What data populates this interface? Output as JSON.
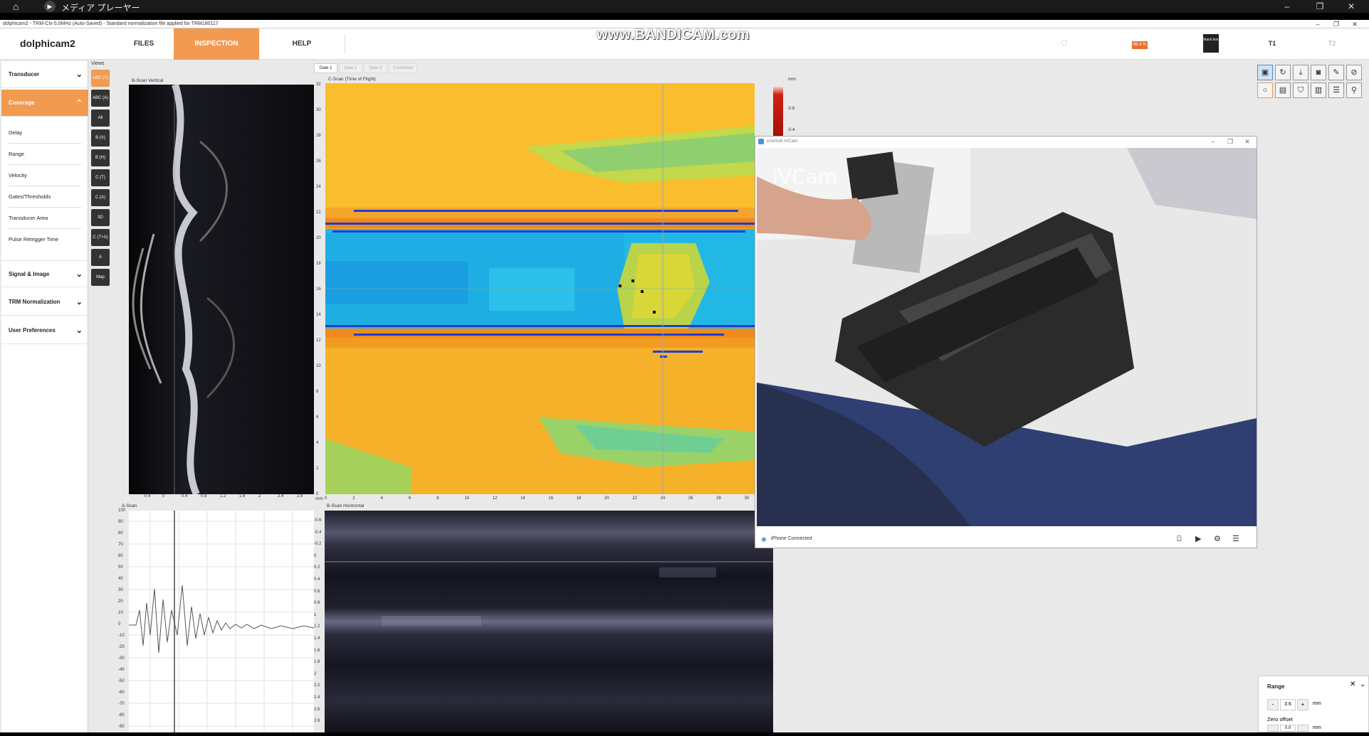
{
  "player": {
    "home_icon": "home-icon",
    "play_icon": "play-icon",
    "title": "メディア プレーヤー",
    "minimize": "–",
    "restore": "❐",
    "close": "✕"
  },
  "app": {
    "titlebar_text": "dolphicam2 - TRM-Clx-5.0MHz (Auto-Saved) - Standard normalization file applied for TRM180117",
    "logo": "dolphicam2",
    "menu": {
      "files": "FILES",
      "inspection": "INSPECTION",
      "help": "HELP"
    },
    "battery_label": "99.4 %",
    "box_label": "black box",
    "t1": "T1",
    "t2": "T2"
  },
  "watermark": "www.BANDICAM.com",
  "sidebar": {
    "sections": [
      {
        "label": "Transducer",
        "icon": "chevron-down-icon"
      },
      {
        "label": "Coverage",
        "icon": "chevron-up-icon"
      },
      {
        "label": "Signal & Image",
        "icon": "chevron-down-icon"
      },
      {
        "label": "TRM Normalization",
        "icon": "chevron-down-icon"
      },
      {
        "label": "User Preferences",
        "icon": "chevron-down-icon"
      }
    ],
    "coverage_items": [
      "Delay",
      "Range",
      "Velocity",
      "Gates/Thresholds",
      "Transducer Area",
      "Pulse Retrigger Time"
    ]
  },
  "views": {
    "label": "Views",
    "buttons": [
      "ABC (T)",
      "ABC (A)",
      "All",
      "B (V)",
      "B (H)",
      "C (T)",
      "C (A)",
      "3D",
      "C (T+A)",
      "A",
      "Map"
    ]
  },
  "gates": [
    "Gate 1",
    "Gate 2",
    "Gate 3",
    "Combined"
  ],
  "panels": {
    "bscan_v": "B-Scan Vertical",
    "cscan": "C-Scan (Time of Flight)",
    "ascan": "A-Scan",
    "bscan_h": "B-Scan Horizontal",
    "cscan_unit": "mm",
    "bscan_unit": "mm"
  },
  "axes": {
    "bscan_v_x": [
      "-0.4",
      "0",
      "0.4",
      "0.8",
      "1.2",
      "1.6",
      "2",
      "2.4",
      "2.8"
    ],
    "cscan_x": [
      "0",
      "2",
      "4",
      "6",
      "8",
      "10",
      "12",
      "14",
      "16",
      "18",
      "20",
      "22",
      "24",
      "26",
      "28",
      "30"
    ],
    "cscan_y": [
      "32",
      "30",
      "28",
      "26",
      "24",
      "22",
      "20",
      "18",
      "16",
      "14",
      "12",
      "10",
      "8",
      "6",
      "4",
      "2",
      "0"
    ],
    "colorbar": [
      "-0.6",
      "-0.4"
    ],
    "ascan_y": [
      "100",
      "90",
      "80",
      "70",
      "60",
      "50",
      "40",
      "30",
      "20",
      "10",
      "0",
      "-10",
      "-20",
      "-30",
      "-40",
      "-50",
      "-60",
      "-70",
      "-80",
      "-90"
    ],
    "bscan_h_y": [
      "-0.6",
      "-0.4",
      "-0.2",
      "0",
      "0.2",
      "0.4",
      "0.6",
      "0.8",
      "1",
      "1.2",
      "1.4",
      "1.6",
      "1.8",
      "2",
      "2.2",
      "2.4",
      "2.6",
      "2.8"
    ]
  },
  "ivcam": {
    "title": "e2eSoft iVCam",
    "watermark": "iVCam",
    "status": "iPhone Connected",
    "buttons": [
      "camera-icon",
      "video-icon",
      "gear-icon",
      "menu-icon"
    ]
  },
  "range_widget": {
    "title": "Range",
    "minus": "-",
    "value": "3.6",
    "plus": "+",
    "unit": "mm",
    "zero_offset": "Zero offset",
    "zero_value": "0.0",
    "zero_unit": "mm"
  }
}
